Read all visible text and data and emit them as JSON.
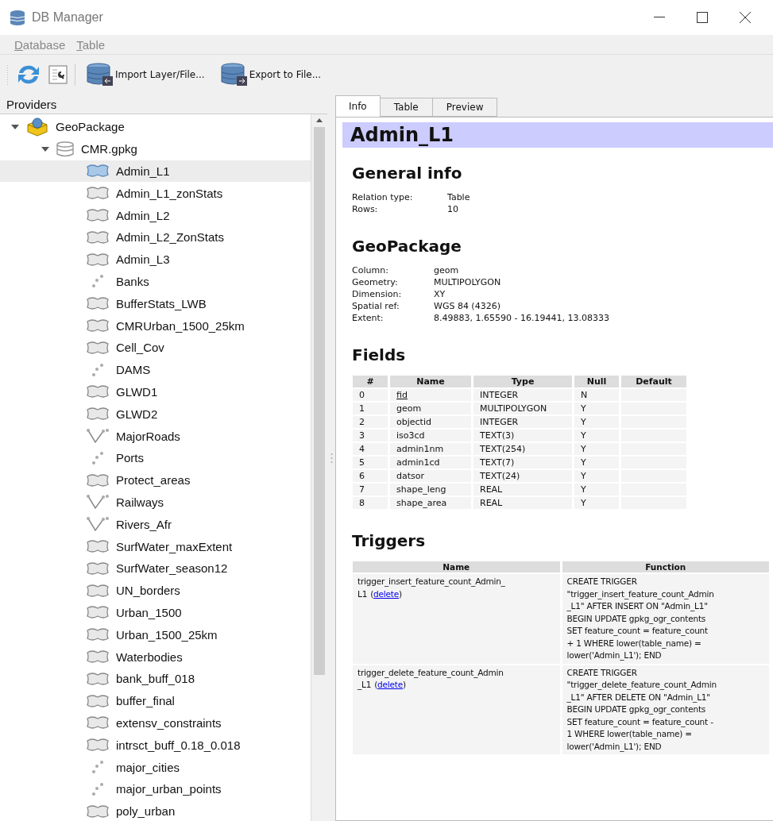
{
  "window": {
    "title": "DB Manager"
  },
  "menu": [
    {
      "label": "Database"
    },
    {
      "label": "Table"
    }
  ],
  "toolbar": [
    {
      "kind": "refresh"
    },
    {
      "kind": "info"
    },
    {
      "kind": "separator"
    },
    {
      "kind": "import",
      "label": "Import Layer/File..."
    },
    {
      "kind": "export",
      "label": "Export to File..."
    }
  ],
  "providers": {
    "title": "Providers",
    "tree": [
      {
        "label": "GeoPackage",
        "kind": "provider",
        "expanded": true,
        "selected": false,
        "children": [
          {
            "label": "CMR.gpkg",
            "kind": "database",
            "expanded": true,
            "selected": false,
            "children": [
              {
                "label": "Admin_L1",
                "kind": "polygon",
                "selected": true
              },
              {
                "label": "Admin_L1_zonStats",
                "kind": "polygon",
                "selected": false
              },
              {
                "label": "Admin_L2",
                "kind": "polygon",
                "selected": false
              },
              {
                "label": "Admin_L2_ZonStats",
                "kind": "polygon",
                "selected": false
              },
              {
                "label": "Admin_L3",
                "kind": "polygon",
                "selected": false
              },
              {
                "label": "Banks",
                "kind": "point",
                "selected": false
              },
              {
                "label": "BufferStats_LWB",
                "kind": "polygon",
                "selected": false
              },
              {
                "label": "CMRUrban_1500_25km",
                "kind": "polygon",
                "selected": false
              },
              {
                "label": "Cell_Cov",
                "kind": "polygon",
                "selected": false
              },
              {
                "label": "DAMS",
                "kind": "point",
                "selected": false
              },
              {
                "label": "GLWD1",
                "kind": "polygon",
                "selected": false
              },
              {
                "label": "GLWD2",
                "kind": "polygon",
                "selected": false
              },
              {
                "label": "MajorRoads",
                "kind": "line",
                "selected": false
              },
              {
                "label": "Ports",
                "kind": "point",
                "selected": false
              },
              {
                "label": "Protect_areas",
                "kind": "polygon",
                "selected": false
              },
              {
                "label": "Railways",
                "kind": "line",
                "selected": false
              },
              {
                "label": "Rivers_Afr",
                "kind": "line",
                "selected": false
              },
              {
                "label": "SurfWater_maxExtent",
                "kind": "polygon",
                "selected": false
              },
              {
                "label": "SurfWater_season12",
                "kind": "polygon",
                "selected": false
              },
              {
                "label": "UN_borders",
                "kind": "polygon",
                "selected": false
              },
              {
                "label": "Urban_1500",
                "kind": "polygon",
                "selected": false
              },
              {
                "label": "Urban_1500_25km",
                "kind": "polygon",
                "selected": false
              },
              {
                "label": "Waterbodies",
                "kind": "polygon",
                "selected": false
              },
              {
                "label": "bank_buff_018",
                "kind": "polygon",
                "selected": false
              },
              {
                "label": "buffer_final",
                "kind": "polygon",
                "selected": false
              },
              {
                "label": "extensv_constraints",
                "kind": "polygon",
                "selected": false
              },
              {
                "label": "intrsct_buff_0.18_0.018",
                "kind": "polygon",
                "selected": false
              },
              {
                "label": "major_cities",
                "kind": "point",
                "selected": false
              },
              {
                "label": "major_urban_points",
                "kind": "point",
                "selected": false
              },
              {
                "label": "poly_urban",
                "kind": "polygon",
                "selected": false
              }
            ]
          }
        ]
      }
    ]
  },
  "tabs": [
    {
      "label": "Info",
      "selected": true
    },
    {
      "label": "Table",
      "selected": false
    },
    {
      "label": "Preview",
      "selected": false
    }
  ],
  "info": {
    "title": "Admin_L1",
    "general": {
      "heading": "General info",
      "rows": [
        {
          "label": "Relation type:",
          "value": "Table"
        },
        {
          "label": "Rows:",
          "value": "10"
        }
      ]
    },
    "geopackage": {
      "heading": "GeoPackage",
      "rows": [
        {
          "label": "Column:",
          "value": "geom"
        },
        {
          "label": "Geometry:",
          "value": "MULTIPOLYGON"
        },
        {
          "label": "Dimension:",
          "value": "XY"
        },
        {
          "label": "Spatial ref:",
          "value": "WGS 84 (4326)"
        },
        {
          "label": "Extent:",
          "value": "8.49883, 1.65590 - 16.19441, 13.08333"
        }
      ]
    },
    "fields": {
      "heading": "Fields",
      "columns": [
        "#",
        "Name",
        "Type",
        "Null",
        "Default"
      ],
      "rows": [
        {
          "index": "0",
          "name": "fid",
          "type": "INTEGER",
          "null": "N",
          "primary_key": true
        },
        {
          "index": "1",
          "name": "geom",
          "type": "MULTIPOLYGON",
          "null": "Y",
          "primary_key": false
        },
        {
          "index": "2",
          "name": "objectid",
          "type": "INTEGER",
          "null": "Y",
          "primary_key": false
        },
        {
          "index": "3",
          "name": "iso3cd",
          "type": "TEXT(3)",
          "null": "Y",
          "primary_key": false
        },
        {
          "index": "4",
          "name": "admin1nm",
          "type": "TEXT(254)",
          "null": "Y",
          "primary_key": false
        },
        {
          "index": "5",
          "name": "admin1cd",
          "type": "TEXT(7)",
          "null": "Y",
          "primary_key": false
        },
        {
          "index": "6",
          "name": "datsor",
          "type": "TEXT(24)",
          "null": "Y",
          "primary_key": false
        },
        {
          "index": "7",
          "name": "shape_leng",
          "type": "REAL",
          "null": "Y",
          "primary_key": false
        },
        {
          "index": "8",
          "name": "shape_area",
          "type": "REAL",
          "null": "Y",
          "primary_key": false
        }
      ]
    },
    "triggers": {
      "heading": "Triggers",
      "columns": [
        "Name",
        "Function"
      ],
      "rows": [
        {
          "name": [
            "trigger_insert_feature_count_Admin_",
            "L1"
          ],
          "link": "(delete)",
          "function": [
            "CREATE TRIGGER",
            "\"trigger_insert_feature_count_Admin",
            "_L1\" AFTER INSERT ON \"Admin_L1\"",
            "BEGIN UPDATE gpkg_ogr_contents",
            "SET feature_count = feature_count",
            "+ 1 WHERE lower(table_name) =",
            "lower('Admin_L1'); END"
          ]
        },
        {
          "name": [
            "trigger_delete_feature_count_Admin",
            "_L1"
          ],
          "link": "(delete)",
          "function": [
            "CREATE TRIGGER",
            "\"trigger_delete_feature_count_Admin",
            "_L1\" AFTER DELETE ON \"Admin_L1\"",
            "BEGIN UPDATE gpkg_ogr_contents",
            "SET feature_count = feature_count -",
            "1 WHERE lower(table_name) =",
            "lower('Admin_L1'); END"
          ]
        }
      ]
    }
  }
}
